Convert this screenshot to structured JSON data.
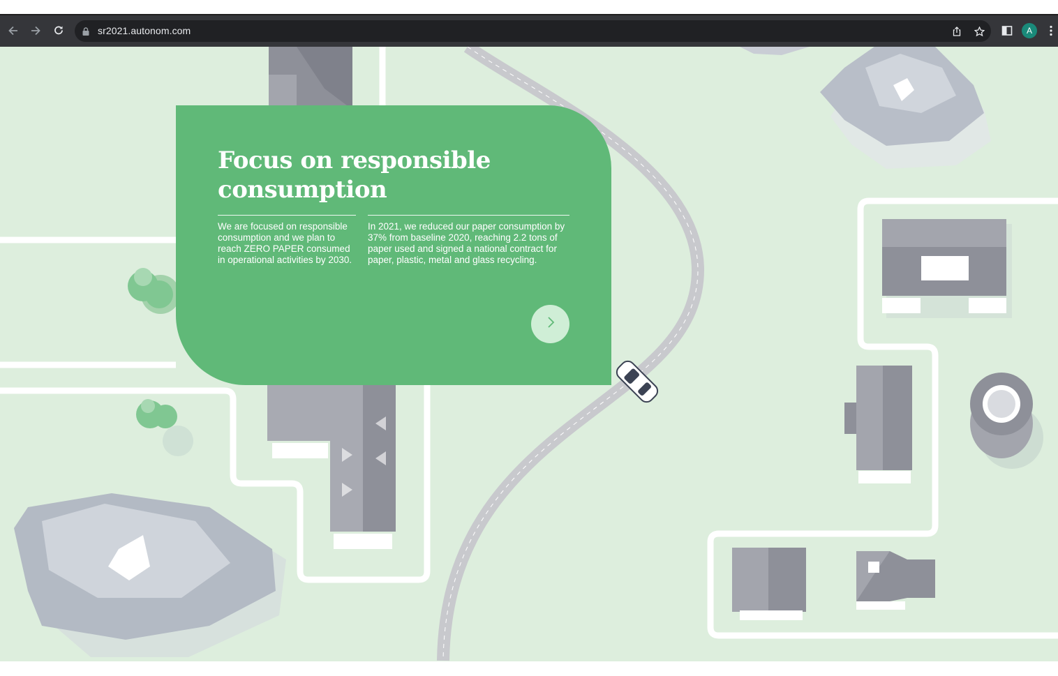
{
  "browser": {
    "url": "sr2021.autonom.com",
    "profile_initial": "A",
    "icons": [
      "back-arrow-icon",
      "forward-arrow-icon",
      "reload-icon",
      "lock-icon",
      "share-icon",
      "bookmark-star-icon",
      "side-panel-icon",
      "kebab-menu-icon"
    ]
  },
  "card": {
    "title": "Focus on responsible consumption",
    "col1": "We are focused on responsible consumption and we plan to reach ZERO PAPER consumed in operational activities by 2030.",
    "col2": "In 2021, we reduced our paper consumption by 37% from baseline 2020, reaching 2.2 tons of paper used and signed a national contract for paper, plastic, metal and glass recycling.",
    "next_icon": "chevron-right-icon"
  },
  "colors": {
    "card_green": "#60b978",
    "map_background": "#ddeedd",
    "road_gray": "#c8c9cd",
    "building_gray": "#8e9099"
  }
}
